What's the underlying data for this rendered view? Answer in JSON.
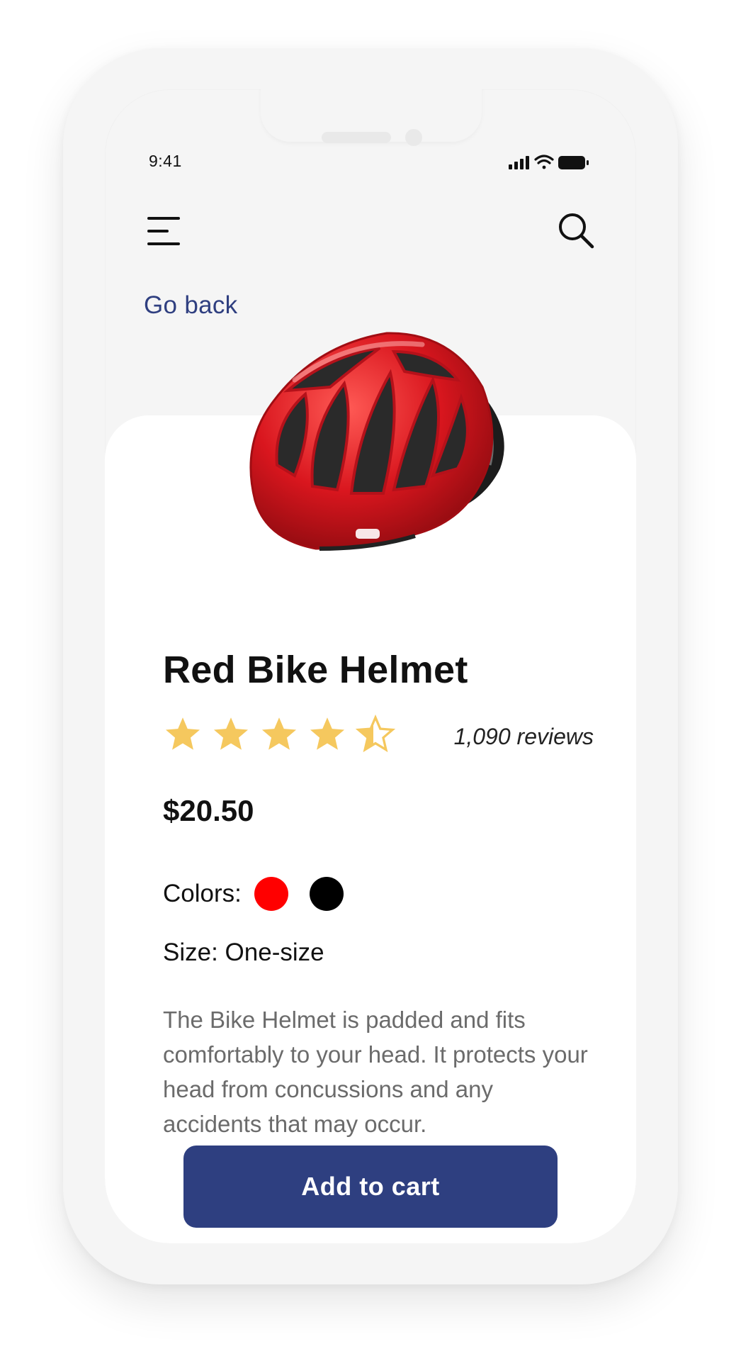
{
  "status_bar": {
    "time": "9:41",
    "icons": [
      "signal-icon",
      "wifi-icon",
      "battery-icon"
    ]
  },
  "header": {
    "menu_icon": "menu-icon",
    "search_icon": "search-icon"
  },
  "nav": {
    "go_back": "Go back"
  },
  "product": {
    "title": "Red Bike Helmet",
    "rating": 4.5,
    "rating_max": 5,
    "reviews": "1,090 reviews",
    "price": "$20.50",
    "colors_label": "Colors:",
    "colors": [
      {
        "name": "red",
        "hex": "#ff0000"
      },
      {
        "name": "black",
        "hex": "#000000"
      }
    ],
    "size_label": "Size",
    "size_value": ": One-size",
    "description": "The Bike Helmet is padded and fits comfortably to your head. It protects your head from concussions and any accidents that may occur.",
    "add_to_cart": "Add to cart"
  },
  "theme": {
    "accent": "#2e3f80",
    "star": "#f5c85e",
    "product_red": "#d9161e"
  }
}
